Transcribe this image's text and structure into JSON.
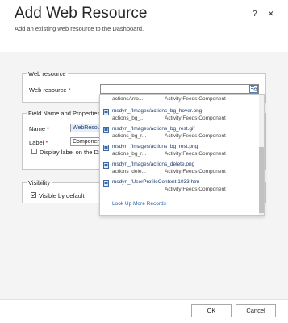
{
  "dialog": {
    "title": "Add Web Resource",
    "subtitle": "Add an existing web resource to the Dashboard.",
    "help_label": "?",
    "close_label": "×"
  },
  "web_resource_section": {
    "legend": "Web resource",
    "field_label": "Web resource",
    "required_marker": "*",
    "value": ""
  },
  "field_section": {
    "legend": "Field Name and Properties",
    "name_label": "Name",
    "name_value": "WebResour",
    "label_label": "Label",
    "label_value": "Component",
    "display_label_text": "Display label on the Dash",
    "required_marker": "*"
  },
  "visibility_section": {
    "legend": "Visibility",
    "visible_label": "Visible by default",
    "visible_checked": true
  },
  "lookup_dropdown": {
    "items": [
      {
        "title": "",
        "name": "actionsArro...",
        "type": "Activity Feeds Component"
      },
      {
        "title": "msdyn_/Images/actions_bg_hover.png",
        "name": "actions_bg_...",
        "type": "Activity Feeds Component"
      },
      {
        "title": "msdyn_/Images/actions_bg_rest.gif",
        "name": "actions_bg_r...",
        "type": "Activity Feeds Component"
      },
      {
        "title": "msdyn_/Images/actions_bg_rest.png",
        "name": "actions_bg_r...",
        "type": "Activity Feeds Component"
      },
      {
        "title": "msdyn_/Images/actions_delete.png",
        "name": "actions_dele...",
        "type": "Activity Feeds Component"
      },
      {
        "title": "msdyn_/UserProfileContent.1033.htm",
        "name": "",
        "type": "Activity Feeds Component"
      }
    ],
    "look_up_more": "Look Up More Records"
  },
  "footer": {
    "ok_label": "OK",
    "cancel_label": "Cancel"
  },
  "colors": {
    "accent": "#1f5fa8",
    "required": "#cc0000",
    "background": "#f4f4f4"
  }
}
